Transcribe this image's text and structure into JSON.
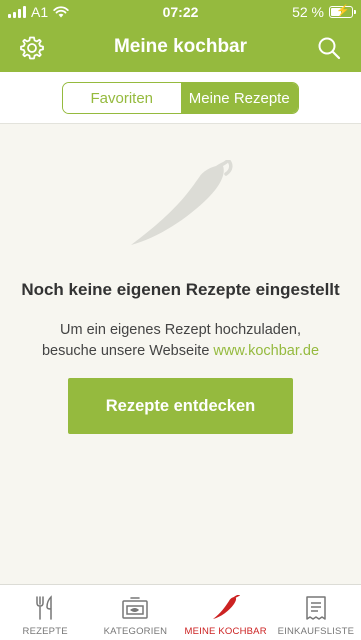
{
  "status_bar": {
    "carrier": "A1",
    "time": "07:22",
    "battery": "52 %"
  },
  "app_bar": {
    "title": "Meine kochbar",
    "left_icon": "gear-icon",
    "right_icon": "search-icon"
  },
  "tabs": [
    {
      "label": "Favoriten",
      "active": false
    },
    {
      "label": "Meine Rezepte",
      "active": true
    }
  ],
  "empty_state": {
    "icon": "chili-pepper-icon",
    "title": "Noch keine eigenen Rezepte eingestellt",
    "text_line1": "Um ein eigenes Rezept hochzuladen,",
    "text_line2_prefix": "besuche unsere Webseite ",
    "link": "www.kochbar.de",
    "button": "Rezepte entdecken"
  },
  "bottom_nav": [
    {
      "label": "REZEPTE",
      "icon": "fork-knife-icon",
      "active": false
    },
    {
      "label": "KATEGORIEN",
      "icon": "categories-icon",
      "active": false
    },
    {
      "label": "MEINE KOCHBAR",
      "icon": "chili-pepper-icon",
      "active": true
    },
    {
      "label": "EINKAUFSLISTE",
      "icon": "shopping-list-icon",
      "active": false
    }
  ],
  "colors": {
    "brand_green": "#95ba3e",
    "active_red": "#cc2222",
    "background": "#f7f6f0"
  }
}
